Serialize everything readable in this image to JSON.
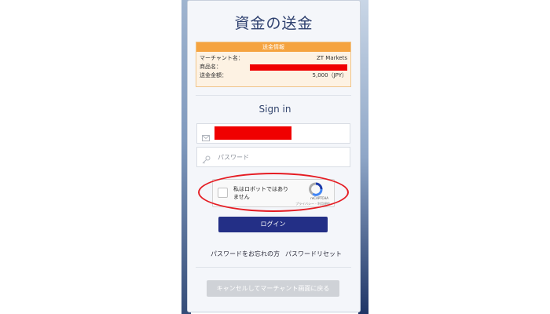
{
  "page": {
    "title": "資金の送金"
  },
  "payment_info": {
    "header": "送金情報",
    "merchant_label": "マーチャント名：",
    "merchant_value": "ZT Markets",
    "product_label": "商品名：",
    "amount_label": "送金金額：",
    "amount_value": "5,000（JPY）"
  },
  "signin": {
    "heading": "Sign in",
    "password_placeholder": "パスワード",
    "login_label": "ログイン",
    "forgot_password": "パスワードをお忘れの方",
    "reset_password": "パスワードリセット",
    "cancel_label": "キャンセルしてマーチャント画面に戻る"
  },
  "captcha": {
    "label": "私はロボットではありません",
    "brand": "reCAPTCHA",
    "terms": "プライバシー - 利用規約"
  },
  "colors": {
    "accent": "#232f86",
    "info_header": "#f5a33f",
    "annotation": "#e51c23",
    "redaction": "#f00000"
  }
}
